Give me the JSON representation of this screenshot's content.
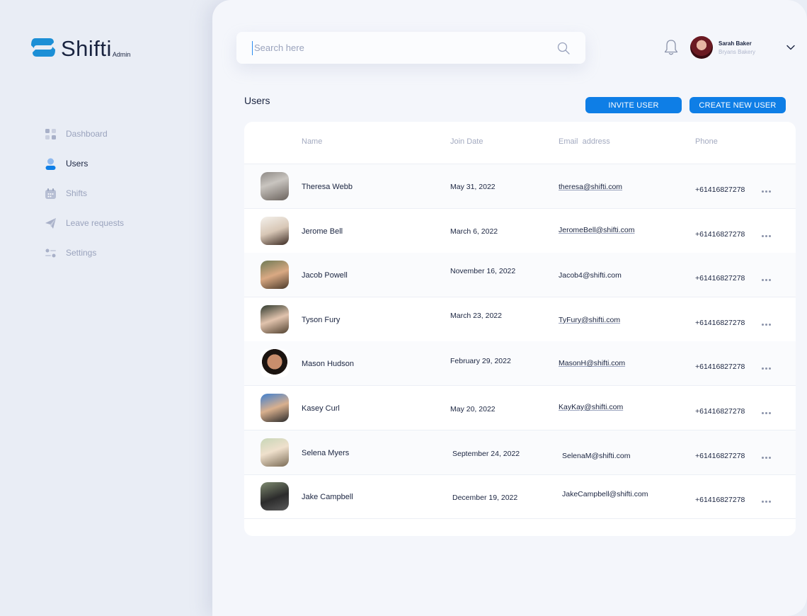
{
  "brand": {
    "name": "Shifti",
    "subtitle": "Admin",
    "colors": {
      "accent": "#0e7ee6",
      "logo": "#1c8fd6"
    }
  },
  "sidebar": {
    "items": [
      {
        "label": "Dashboard",
        "icon": "dashboard-icon",
        "active": false
      },
      {
        "label": "Users",
        "icon": "user-icon",
        "active": true
      },
      {
        "label": "Shifts",
        "icon": "calendar-icon",
        "active": false
      },
      {
        "label": "Leave requests",
        "icon": "send-icon",
        "active": false
      },
      {
        "label": "Settings",
        "icon": "settings-sliders-icon",
        "active": false
      }
    ]
  },
  "header": {
    "search": {
      "placeholder": "Search here",
      "value": ""
    },
    "user": {
      "name": "Sarah Baker",
      "company": "Bryans Bakery"
    }
  },
  "page": {
    "title": "Users",
    "buttons": {
      "invite": "INVITE USER",
      "create": "CREATE NEW USER"
    }
  },
  "table": {
    "columns": [
      "Name",
      "Join Date",
      "Email  address",
      "Phone"
    ],
    "rows": [
      {
        "name": "Theresa Webb",
        "join_date": "May 31, 2022",
        "email": "theresa@shifti.com",
        "phone": "+61416827278"
      },
      {
        "name": "Jerome Bell",
        "join_date": "March 6, 2022",
        "email": "JeromeBell@shifti.com",
        "phone": "+61416827278"
      },
      {
        "name": "Jacob Powell",
        "join_date": "November 16, 2022",
        "email": "Jacob4@shifti.com",
        "phone": "+61416827278"
      },
      {
        "name": "Tyson Fury",
        "join_date": "March 23, 2022",
        "email": "TyFury@shifti.com",
        "phone": "+61416827278"
      },
      {
        "name": "Mason Hudson",
        "join_date": "February 29, 2022",
        "email": "MasonH@shifti.com",
        "phone": "+61416827278"
      },
      {
        "name": "Kasey Curl",
        "join_date": "May 20, 2022",
        "email": "KayKay@shifti.com",
        "phone": "+61416827278"
      },
      {
        "name": "Selena Myers",
        "join_date": "September 24, 2022",
        "email": "SelenaM@shifti.com",
        "phone": "+61416827278"
      },
      {
        "name": "Jake Campbell",
        "join_date": "December 19, 2022",
        "email": "JakeCampbell@shifti.com",
        "phone": "+61416827278"
      }
    ]
  }
}
